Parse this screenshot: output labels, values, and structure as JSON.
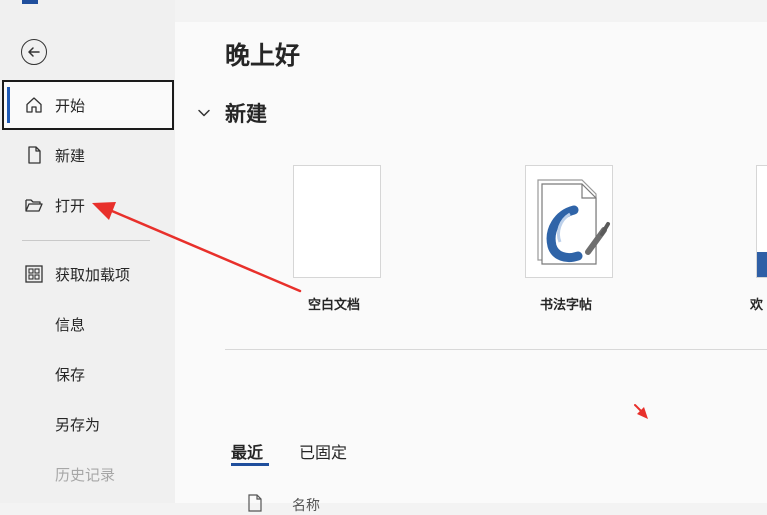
{
  "sidebar": {
    "back_label": "back",
    "items": [
      {
        "label": "开始"
      },
      {
        "label": "新建"
      },
      {
        "label": "打开"
      },
      {
        "label": "获取加载项"
      },
      {
        "label": "信息"
      },
      {
        "label": "保存"
      },
      {
        "label": "另存为"
      },
      {
        "label": "历史记录"
      }
    ]
  },
  "main": {
    "greeting": "晚上好",
    "new_section_title": "新建",
    "templates": [
      {
        "label": "空白文档"
      },
      {
        "label": "书法字帖"
      },
      {
        "label": "欢"
      }
    ],
    "tabs": [
      {
        "label": "最近"
      },
      {
        "label": "已固定"
      }
    ],
    "list_header": "名称"
  },
  "colors": {
    "accent": "#1f4e9c",
    "annotation": "#e8302b"
  }
}
